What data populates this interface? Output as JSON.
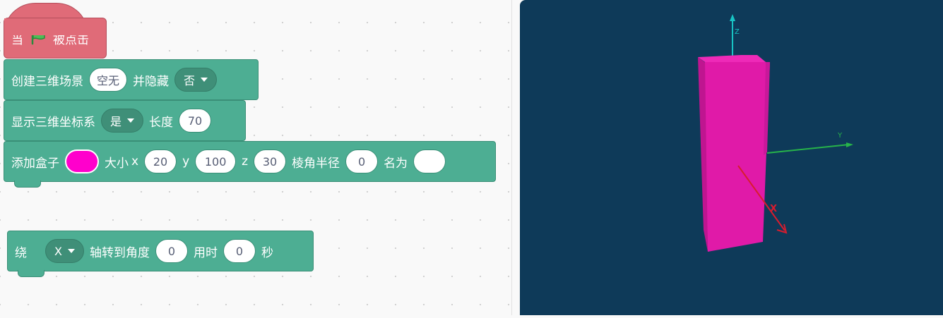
{
  "hat_block": {
    "label_when": "当",
    "flag_icon": "green-flag-icon",
    "label_clicked": "被点击"
  },
  "create_scene_block": {
    "label": "创建三维场景",
    "scene_value": "空无",
    "label_hide": "并隐藏",
    "hide_value": "否"
  },
  "show_axes_block": {
    "label": "显示三维坐标系",
    "show_value": "是",
    "label_length": "长度",
    "length_value": "70"
  },
  "add_box_block": {
    "label": "添加盒子",
    "color": "#ff00cc",
    "label_size": "大小",
    "label_x": "x",
    "x_value": "20",
    "label_y": "y",
    "y_value": "100",
    "label_z": "z",
    "z_value": "30",
    "label_radius": "棱角半径",
    "radius_value": "0",
    "label_name": "名为",
    "name_value": ""
  },
  "rotate_block": {
    "label_around": "绕",
    "axis_value": "X",
    "label_rotate": "轴转到角度",
    "angle_value": "0",
    "label_time": "用时",
    "time_value": "0",
    "label_sec": "秒"
  },
  "stage": {
    "axis_x_label": "X",
    "axis_y_label": "Y",
    "axis_z_label": "Z",
    "box_color": "#e01aa8"
  },
  "colors": {
    "block_green": "#4dae93",
    "hat_red": "#e06b78",
    "stage_bg": "#0e3a59"
  }
}
